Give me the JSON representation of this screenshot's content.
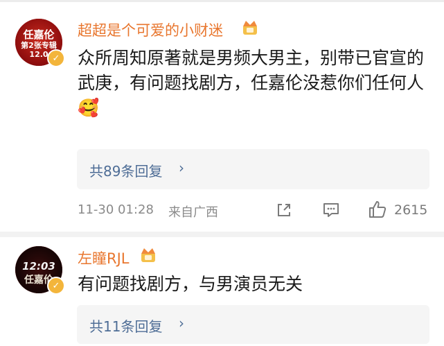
{
  "comments": [
    {
      "username": "超超是个可爱的小财迷",
      "avatar": {
        "line1": "任嘉伦",
        "line2": "第2张专辑",
        "line3": "12.0"
      },
      "text": "众所周知原著就是男频大男主，别带已官宣的武庚，有问题找剧方，任嘉伦没惹你们任何人",
      "emoji": "🥰",
      "replies_label": "共89条回复",
      "timestamp": "11-30 01:28",
      "location": "来自广西",
      "likes": "2615"
    },
    {
      "username": "左瞳RJL",
      "avatar": {
        "line1": "12:03",
        "line2": "任嘉伦"
      },
      "text": "有问题找剧方，与男演员无关",
      "replies_label": "共11条回复"
    }
  ],
  "colors": {
    "username": "#e8762e",
    "reply_link": "#4e6d96",
    "meta": "#8a8a8a",
    "verify_badge": "#f3b53b"
  },
  "icons": [
    "verified-badge-icon",
    "vip-crown-icon",
    "share-icon",
    "comment-icon",
    "like-icon",
    "chevron-right-icon"
  ]
}
